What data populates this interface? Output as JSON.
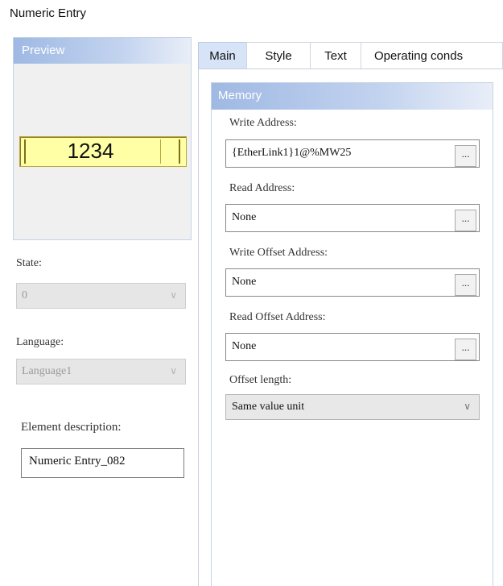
{
  "window": {
    "title": "Numeric Entry"
  },
  "preview": {
    "header": "Preview",
    "value": "1234"
  },
  "state": {
    "label": "State:",
    "value": "0"
  },
  "language": {
    "label": "Language:",
    "value": "Language1"
  },
  "description": {
    "label": "Element description:",
    "value": "Numeric Entry_082"
  },
  "tabs": [
    {
      "label": "Main",
      "active": true
    },
    {
      "label": "Style"
    },
    {
      "label": "Text"
    },
    {
      "label": "Operating conds"
    }
  ],
  "memory": {
    "header": "Memory",
    "browse_label": "...",
    "write_address": {
      "label": "Write Address:",
      "value": "{EtherLink1}1@%MW25"
    },
    "read_address": {
      "label": "Read Address:",
      "value": "None"
    },
    "write_offset": {
      "label": "Write Offset Address:",
      "value": "None"
    },
    "read_offset": {
      "label": "Read Offset Address:",
      "value": "None"
    },
    "offset_length": {
      "label": "Offset length:",
      "value": "Same value unit"
    }
  },
  "colors": {
    "preview_widget": "#ffffa6",
    "header_gradient": "#9fb9e3",
    "active_tab": "#d7e4f7"
  },
  "icons": {
    "dropdown": "chevron-down-icon",
    "browse": "ellipsis-button"
  }
}
